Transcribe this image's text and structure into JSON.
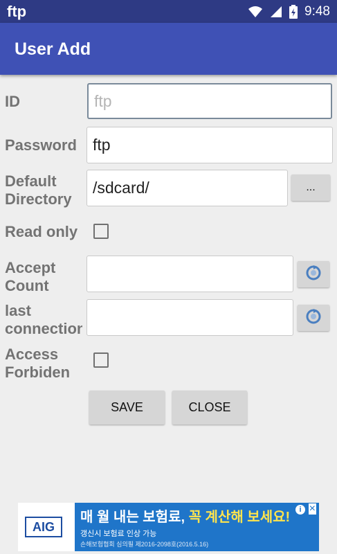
{
  "status_bar": {
    "app_name": "ftp",
    "time": "9:48"
  },
  "app_bar": {
    "title": "User Add"
  },
  "form": {
    "id": {
      "label": "ID",
      "placeholder": "ftp",
      "value": ""
    },
    "password": {
      "label": "Password",
      "value": "ftp"
    },
    "default_directory": {
      "label_line1": "Default",
      "label_line2": "Directory",
      "value": "/sdcard/",
      "browse_label": "..."
    },
    "read_only": {
      "label": "Read only",
      "checked": false
    },
    "accept_count": {
      "label_line1": "Accept",
      "label_line2": "Count",
      "value": ""
    },
    "last_connection": {
      "label_line1": "last",
      "label_line2": "connection",
      "value": ""
    },
    "access_forbidden": {
      "label_line1": "Access",
      "label_line2": "Forbiden",
      "checked": false
    }
  },
  "buttons": {
    "save_label": "SAVE",
    "close_label": "CLOSE"
  },
  "ad": {
    "logo": "AIG",
    "headline_white": "매 월 내는 보험료,",
    "headline_yellow": "꼭 계산해 보세요!",
    "subtext": "갱신시 보험료 인상 가능",
    "fine_print": "손해보험협회 심의필 제2016-2098호(2016.5.16)",
    "info_icon": "i",
    "close_icon": "×"
  },
  "colors": {
    "status_bar": "#2e3a84",
    "app_bar": "#3f51b5",
    "ad_banner": "#1f75c9"
  }
}
